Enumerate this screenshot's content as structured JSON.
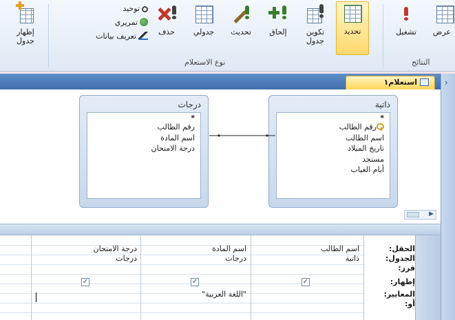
{
  "ribbon": {
    "buttons": {
      "show_table": "إظهار\nجدول",
      "delete": "حذف",
      "crosstab": "جدولي",
      "update": "تحديث",
      "append": "إلحاق",
      "make_table": "تكوين\nجدول",
      "select": "تحديد",
      "run": "تشغيل",
      "view": "عرض"
    },
    "stack": {
      "union": "توحيد",
      "pass_through": "تمريري",
      "data_definition": "تعريف بيانات"
    },
    "groups": {
      "query_type": "نوع الاستعلام",
      "results": "النتائج"
    }
  },
  "document_tab": {
    "title": "استعلام١"
  },
  "tables": [
    {
      "title": "ذاتية",
      "star": "*",
      "fields": [
        "رقم الطالب",
        "اسم الطالب",
        "تاريخ الميلاد",
        "مستجد",
        "أيام الغياب"
      ],
      "primary_key_field": 0
    },
    {
      "title": "درجات",
      "star": "*",
      "fields": [
        "رقم الطالب",
        "اسم المادة",
        "درجة الامتحان"
      ]
    }
  ],
  "grid": {
    "row_labels": {
      "field": "الحقل:",
      "table": "الجدول:",
      "sort": "فرز:",
      "show": "إظهار:",
      "criteria": "المعايير:",
      "or": "أو:"
    },
    "columns": [
      {
        "field": "اسم الطالب",
        "table": "ذاتية",
        "sort": "",
        "show": true,
        "criteria": ""
      },
      {
        "field": "اسم المادة",
        "table": "درجات",
        "sort": "",
        "show": true,
        "criteria": "\"اللغة العربية\""
      },
      {
        "field": "درجة الامتحان",
        "table": "درجات",
        "sort": "",
        "show": true,
        "criteria": ""
      }
    ]
  },
  "colors": {
    "accent_blue": "#3f6ea9",
    "active_button": "#ffd86b",
    "background_pink": "#fbe3e6"
  }
}
